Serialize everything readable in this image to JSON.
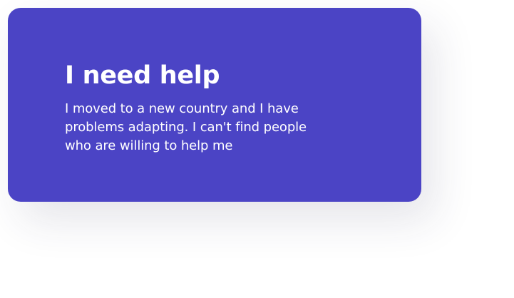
{
  "card": {
    "title": "I need help",
    "description": "I moved to a new country and I have problems adapting. I can't find people who are willing to help me",
    "background_color": "#4b44c5",
    "text_color": "#ffffff"
  }
}
